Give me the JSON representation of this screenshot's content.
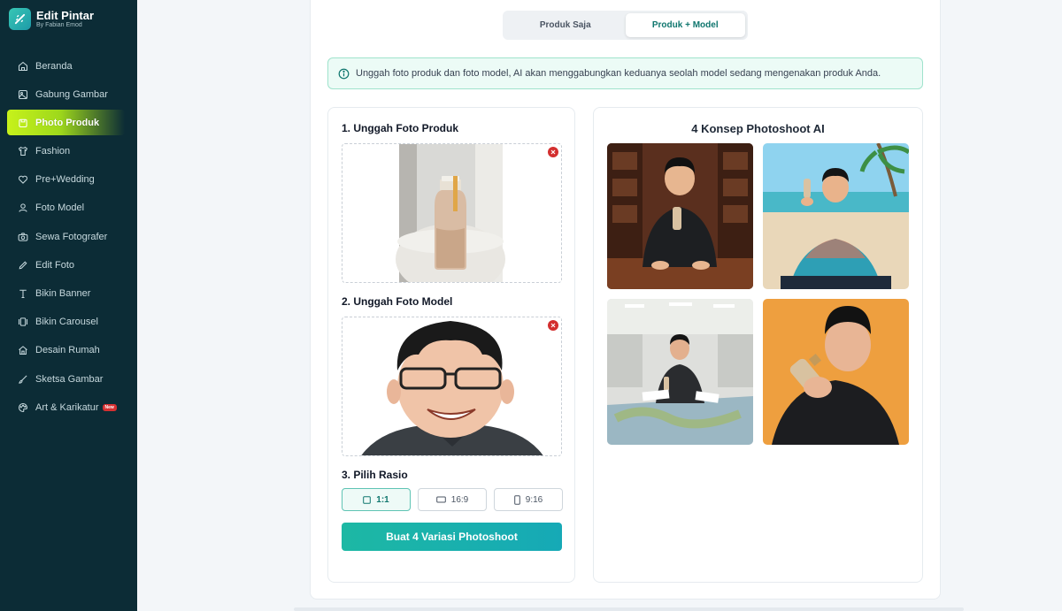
{
  "brand": {
    "name": "Edit Pintar",
    "subtitle": "By Fabian Emod"
  },
  "sidebar": {
    "items": [
      {
        "label": "Beranda",
        "icon": "home-icon"
      },
      {
        "label": "Gabung Gambar",
        "icon": "image-icon"
      },
      {
        "label": "Photo Produk",
        "icon": "product-icon",
        "active": true
      },
      {
        "label": "Fashion",
        "icon": "shirt-icon"
      },
      {
        "label": "Pre+Wedding",
        "icon": "heart-icon"
      },
      {
        "label": "Foto Model",
        "icon": "user-icon"
      },
      {
        "label": "Sewa Fotografer",
        "icon": "camera-icon"
      },
      {
        "label": "Edit Foto",
        "icon": "pencil-icon"
      },
      {
        "label": "Bikin Banner",
        "icon": "type-icon"
      },
      {
        "label": "Bikin Carousel",
        "icon": "carousel-icon"
      },
      {
        "label": "Desain Rumah",
        "icon": "house-icon"
      },
      {
        "label": "Sketsa Gambar",
        "icon": "brush-icon"
      },
      {
        "label": "Art & Karikatur",
        "icon": "palette-icon",
        "badge": "New"
      }
    ]
  },
  "mode_tabs": {
    "left": "Produk Saja",
    "right": "Produk + Model",
    "active": "right"
  },
  "info_text": "Unggah foto produk dan foto model, AI akan menggabungkan keduanya seolah model sedang mengenakan produk Anda.",
  "upload": {
    "product_title": "1. Unggah Foto Produk",
    "model_title": "2. Unggah Foto Model",
    "ratio_title": "3. Pilih Rasio"
  },
  "ratios": {
    "square": "1:1",
    "landscape": "16:9",
    "portrait": "9:16",
    "selected": "1:1"
  },
  "generate_label": "Buat 4 Variasi Photoshoot",
  "results_title": "4 Konsep Photoshoot AI",
  "colors": {
    "sidebar_bg": "#0c2c36",
    "accent": "#1db8a4",
    "active_nav": "#c7f21b",
    "remove": "#d32f2f"
  }
}
